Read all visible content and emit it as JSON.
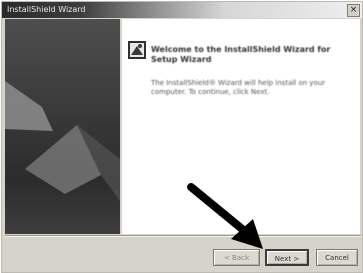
{
  "window": {
    "title": "InstallShield Wizard",
    "close_glyph": "×"
  },
  "side_panel": {
    "icon": "setup-logo-icon"
  },
  "content": {
    "heading": "Welcome to the InstallShield Wizard for Setup Wizard",
    "body": "The InstallShield® Wizard will help install on your computer. To continue, click Next."
  },
  "buttons": {
    "back": "< Back",
    "next": "Next >",
    "cancel": "Cancel"
  },
  "annotation": {
    "icon": "pointer-arrow-icon",
    "color": "#000000"
  },
  "colors": {
    "dialog_bg": "#d6d3cb",
    "side_panel_dark": "#2c2c2c",
    "content_bg": "#ffffff"
  }
}
